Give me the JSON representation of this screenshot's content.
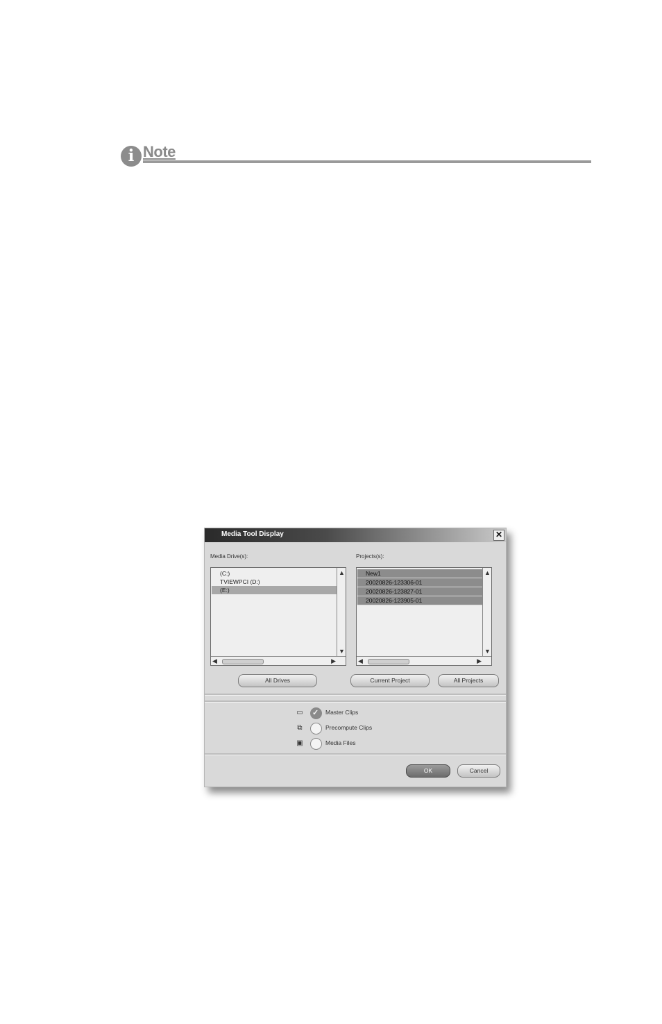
{
  "note": {
    "icon": "info-icon",
    "icon_glyph": "i",
    "title": "Note"
  },
  "dialog": {
    "title": "Media Tool Display",
    "close_glyph": "✕",
    "drives": {
      "label": "Media Drive(s):",
      "items": [
        "(C:)",
        "TVIEWPCI (D:)",
        "(E:)"
      ],
      "selected": "(E:)",
      "button": "All Drives"
    },
    "projects": {
      "label": "Projects(s):",
      "items": [
        "New1",
        "20020826-123306-01",
        "20020826-123827-01",
        "20020826-123905-01"
      ],
      "current_button": "Current Project",
      "all_button": "All Projects"
    },
    "scroll": {
      "up": "▲",
      "down": "▼",
      "left": "◀",
      "right": "▶"
    },
    "options": [
      {
        "icon": "master-clip-icon",
        "glyph": "▭",
        "label": "Master Clips",
        "checked": true
      },
      {
        "icon": "precompute-clip-icon",
        "glyph": "⧉",
        "label": "Precompute Clips",
        "checked": false
      },
      {
        "icon": "media-file-icon",
        "glyph": "▣",
        "label": "Media Files",
        "checked": false
      }
    ],
    "ok_label": "OK",
    "cancel_label": "Cancel"
  }
}
